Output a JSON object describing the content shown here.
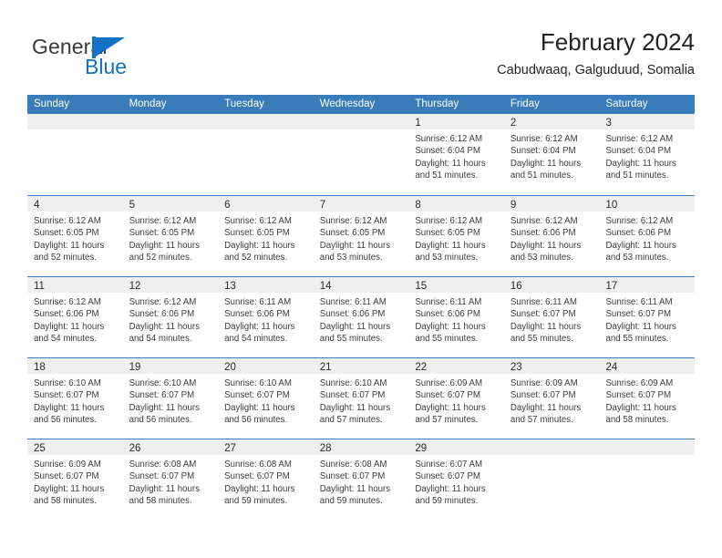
{
  "brand": {
    "name_part1": "General",
    "name_part2": "Blue",
    "flag_icon": "triangle-flag-icon",
    "accent_color": "#1271c4"
  },
  "header": {
    "title": "February 2024",
    "subtitle": "Cabudwaaq, Galguduud, Somalia"
  },
  "theme": {
    "header_blue": "#3a7cba",
    "day_band_gray": "#efefef",
    "text_color": "#3c3c3c"
  },
  "calendar": {
    "weekday_headers": [
      "Sunday",
      "Monday",
      "Tuesday",
      "Wednesday",
      "Thursday",
      "Friday",
      "Saturday"
    ],
    "weeks": [
      [
        {
          "date": "",
          "lines": []
        },
        {
          "date": "",
          "lines": []
        },
        {
          "date": "",
          "lines": []
        },
        {
          "date": "",
          "lines": []
        },
        {
          "date": "1",
          "lines": [
            "Sunrise: 6:12 AM",
            "Sunset: 6:04 PM",
            "Daylight: 11 hours",
            "and 51 minutes."
          ]
        },
        {
          "date": "2",
          "lines": [
            "Sunrise: 6:12 AM",
            "Sunset: 6:04 PM",
            "Daylight: 11 hours",
            "and 51 minutes."
          ]
        },
        {
          "date": "3",
          "lines": [
            "Sunrise: 6:12 AM",
            "Sunset: 6:04 PM",
            "Daylight: 11 hours",
            "and 51 minutes."
          ]
        }
      ],
      [
        {
          "date": "4",
          "lines": [
            "Sunrise: 6:12 AM",
            "Sunset: 6:05 PM",
            "Daylight: 11 hours",
            "and 52 minutes."
          ]
        },
        {
          "date": "5",
          "lines": [
            "Sunrise: 6:12 AM",
            "Sunset: 6:05 PM",
            "Daylight: 11 hours",
            "and 52 minutes."
          ]
        },
        {
          "date": "6",
          "lines": [
            "Sunrise: 6:12 AM",
            "Sunset: 6:05 PM",
            "Daylight: 11 hours",
            "and 52 minutes."
          ]
        },
        {
          "date": "7",
          "lines": [
            "Sunrise: 6:12 AM",
            "Sunset: 6:05 PM",
            "Daylight: 11 hours",
            "and 53 minutes."
          ]
        },
        {
          "date": "8",
          "lines": [
            "Sunrise: 6:12 AM",
            "Sunset: 6:05 PM",
            "Daylight: 11 hours",
            "and 53 minutes."
          ]
        },
        {
          "date": "9",
          "lines": [
            "Sunrise: 6:12 AM",
            "Sunset: 6:06 PM",
            "Daylight: 11 hours",
            "and 53 minutes."
          ]
        },
        {
          "date": "10",
          "lines": [
            "Sunrise: 6:12 AM",
            "Sunset: 6:06 PM",
            "Daylight: 11 hours",
            "and 53 minutes."
          ]
        }
      ],
      [
        {
          "date": "11",
          "lines": [
            "Sunrise: 6:12 AM",
            "Sunset: 6:06 PM",
            "Daylight: 11 hours",
            "and 54 minutes."
          ]
        },
        {
          "date": "12",
          "lines": [
            "Sunrise: 6:12 AM",
            "Sunset: 6:06 PM",
            "Daylight: 11 hours",
            "and 54 minutes."
          ]
        },
        {
          "date": "13",
          "lines": [
            "Sunrise: 6:11 AM",
            "Sunset: 6:06 PM",
            "Daylight: 11 hours",
            "and 54 minutes."
          ]
        },
        {
          "date": "14",
          "lines": [
            "Sunrise: 6:11 AM",
            "Sunset: 6:06 PM",
            "Daylight: 11 hours",
            "and 55 minutes."
          ]
        },
        {
          "date": "15",
          "lines": [
            "Sunrise: 6:11 AM",
            "Sunset: 6:06 PM",
            "Daylight: 11 hours",
            "and 55 minutes."
          ]
        },
        {
          "date": "16",
          "lines": [
            "Sunrise: 6:11 AM",
            "Sunset: 6:07 PM",
            "Daylight: 11 hours",
            "and 55 minutes."
          ]
        },
        {
          "date": "17",
          "lines": [
            "Sunrise: 6:11 AM",
            "Sunset: 6:07 PM",
            "Daylight: 11 hours",
            "and 55 minutes."
          ]
        }
      ],
      [
        {
          "date": "18",
          "lines": [
            "Sunrise: 6:10 AM",
            "Sunset: 6:07 PM",
            "Daylight: 11 hours",
            "and 56 minutes."
          ]
        },
        {
          "date": "19",
          "lines": [
            "Sunrise: 6:10 AM",
            "Sunset: 6:07 PM",
            "Daylight: 11 hours",
            "and 56 minutes."
          ]
        },
        {
          "date": "20",
          "lines": [
            "Sunrise: 6:10 AM",
            "Sunset: 6:07 PM",
            "Daylight: 11 hours",
            "and 56 minutes."
          ]
        },
        {
          "date": "21",
          "lines": [
            "Sunrise: 6:10 AM",
            "Sunset: 6:07 PM",
            "Daylight: 11 hours",
            "and 57 minutes."
          ]
        },
        {
          "date": "22",
          "lines": [
            "Sunrise: 6:09 AM",
            "Sunset: 6:07 PM",
            "Daylight: 11 hours",
            "and 57 minutes."
          ]
        },
        {
          "date": "23",
          "lines": [
            "Sunrise: 6:09 AM",
            "Sunset: 6:07 PM",
            "Daylight: 11 hours",
            "and 57 minutes."
          ]
        },
        {
          "date": "24",
          "lines": [
            "Sunrise: 6:09 AM",
            "Sunset: 6:07 PM",
            "Daylight: 11 hours",
            "and 58 minutes."
          ]
        }
      ],
      [
        {
          "date": "25",
          "lines": [
            "Sunrise: 6:09 AM",
            "Sunset: 6:07 PM",
            "Daylight: 11 hours",
            "and 58 minutes."
          ]
        },
        {
          "date": "26",
          "lines": [
            "Sunrise: 6:08 AM",
            "Sunset: 6:07 PM",
            "Daylight: 11 hours",
            "and 58 minutes."
          ]
        },
        {
          "date": "27",
          "lines": [
            "Sunrise: 6:08 AM",
            "Sunset: 6:07 PM",
            "Daylight: 11 hours",
            "and 59 minutes."
          ]
        },
        {
          "date": "28",
          "lines": [
            "Sunrise: 6:08 AM",
            "Sunset: 6:07 PM",
            "Daylight: 11 hours",
            "and 59 minutes."
          ]
        },
        {
          "date": "29",
          "lines": [
            "Sunrise: 6:07 AM",
            "Sunset: 6:07 PM",
            "Daylight: 11 hours",
            "and 59 minutes."
          ]
        },
        {
          "date": "",
          "lines": []
        },
        {
          "date": "",
          "lines": []
        }
      ]
    ]
  }
}
